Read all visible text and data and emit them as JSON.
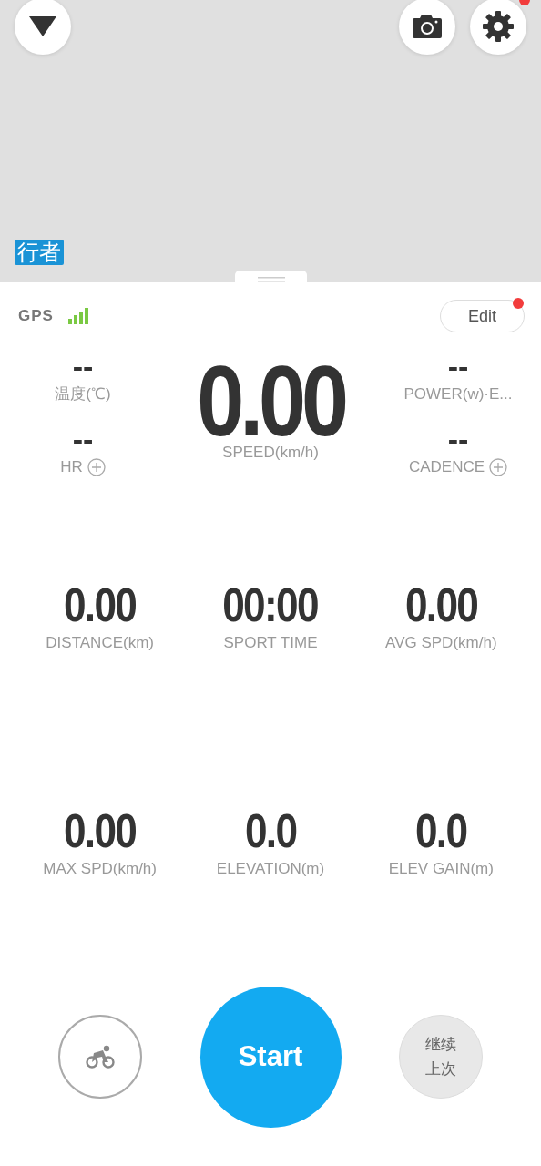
{
  "map": {
    "logo": "行者",
    "settings_badge": true
  },
  "panel": {
    "gps_label": "GPS",
    "edit": {
      "label": "Edit",
      "badge": true
    }
  },
  "left_metrics": [
    {
      "value": "--",
      "label": "温度(℃)",
      "add_button": false
    },
    {
      "value": "--",
      "label": "HR",
      "add_button": true
    }
  ],
  "right_metrics": [
    {
      "value": "--",
      "label": "POWER(w)·E...",
      "add_button": false
    },
    {
      "value": "--",
      "label": "CADENCE",
      "add_button": true
    }
  ],
  "main_metric": {
    "value": "0.00",
    "label": "SPEED(km/h)"
  },
  "grid_metrics": [
    {
      "value": "0.00",
      "label": "DISTANCE(km)"
    },
    {
      "value": "00:00",
      "label": "SPORT TIME"
    },
    {
      "value": "0.00",
      "label": "AVG SPD(km/h)"
    },
    {
      "value": "0.00",
      "label": "MAX SPD(km/h)"
    },
    {
      "value": "0.0",
      "label": "ELEVATION(m)"
    },
    {
      "value": "0.0",
      "label": "ELEV GAIN(m)"
    }
  ],
  "actions": {
    "start": "Start",
    "resume_lines": [
      "继续",
      "上次"
    ]
  }
}
